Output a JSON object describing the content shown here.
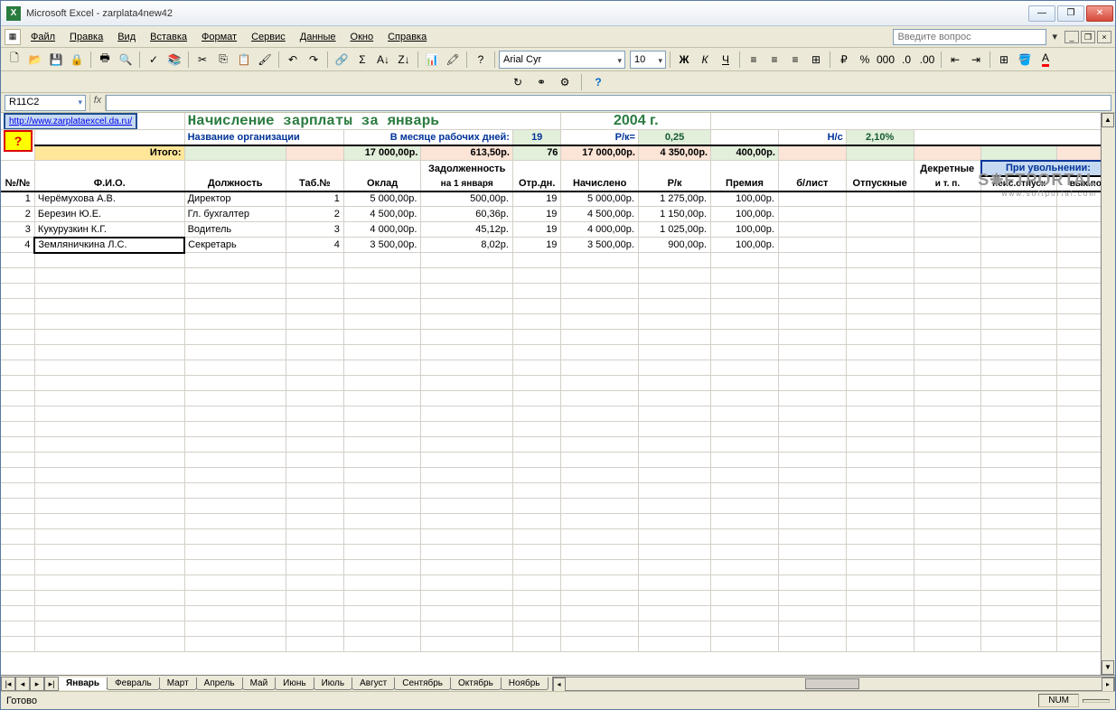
{
  "window": {
    "title": "Microsoft Excel - zarplata4new42"
  },
  "menu": {
    "items": [
      "Файл",
      "Правка",
      "Вид",
      "Вставка",
      "Формат",
      "Сервис",
      "Данные",
      "Окно",
      "Справка"
    ],
    "question_placeholder": "Введите вопрос"
  },
  "font": {
    "name": "Arial Cyr",
    "size": "10"
  },
  "namebox": "R11C2",
  "watermark": {
    "main": "S❋FTPORTAL",
    "sub": "www.softportal.com"
  },
  "doc": {
    "link": "http://www.zarplataexcel.da.ru/",
    "title": "Начисление зарплаты за январь",
    "year": "2004 г.",
    "org_label": "Название организации",
    "days_label": "В месяце рабочих дней:",
    "days_value": "19",
    "rk_label": "Р/к=",
    "rk_value": "0,25",
    "ns_label": "Н/с",
    "ns_value": "2,10%",
    "help": "?",
    "totals_label": "Итого:",
    "totals": {
      "oklad": "17 000,00р.",
      "debt": "613,50р.",
      "days": "76",
      "accrued": "17 000,00р.",
      "rk": "4 350,00р.",
      "bonus": "400,00р."
    }
  },
  "columns": {
    "no": "№/№",
    "fio": "Ф.И.О.",
    "post": "Должность",
    "tab": "Таб.№",
    "oklad": "Оклад",
    "debt": "Задолженность",
    "debt_sub": "на 1 января",
    "days": "Отр.дн.",
    "accrued": "Начислено",
    "rk": "Р/к",
    "bonus": "Премия",
    "sick": "б/лист",
    "vac": "Отпускные",
    "dec": "Декретные",
    "dec_sub": "и т. п.",
    "dismiss": "При увольнении:",
    "dismiss1": "неис.отпуск",
    "dismiss2": "вых.по"
  },
  "rows": [
    {
      "n": "1",
      "fio": "Черёмухова А.В.",
      "post": "Директор",
      "tab": "1",
      "oklad": "5 000,00р.",
      "debt": "500,00р.",
      "days": "19",
      "accrued": "5 000,00р.",
      "rk": "1 275,00р.",
      "bonus": "100,00р."
    },
    {
      "n": "2",
      "fio": "Березин Ю.Е.",
      "post": "Гл. бухгалтер",
      "tab": "2",
      "oklad": "4 500,00р.",
      "debt": "60,36р.",
      "days": "19",
      "accrued": "4 500,00р.",
      "rk": "1 150,00р.",
      "bonus": "100,00р."
    },
    {
      "n": "3",
      "fio": "Кукурузкин К.Г.",
      "post": "Водитель",
      "tab": "3",
      "oklad": "4 000,00р.",
      "debt": "45,12р.",
      "days": "19",
      "accrued": "4 000,00р.",
      "rk": "1 025,00р.",
      "bonus": "100,00р."
    },
    {
      "n": "4",
      "fio": "Земляничкина Л.С.",
      "post": "Секретарь",
      "tab": "4",
      "oklad": "3 500,00р.",
      "debt": "8,02р.",
      "days": "19",
      "accrued": "3 500,00р.",
      "rk": "900,00р.",
      "bonus": "100,00р."
    }
  ],
  "sheets": [
    "Январь",
    "Февраль",
    "Март",
    "Апрель",
    "Май",
    "Июнь",
    "Июль",
    "Август",
    "Сентябрь",
    "Октябрь",
    "Ноябрь"
  ],
  "active_sheet": "Январь",
  "status": {
    "ready": "Готово",
    "num": "NUM"
  }
}
